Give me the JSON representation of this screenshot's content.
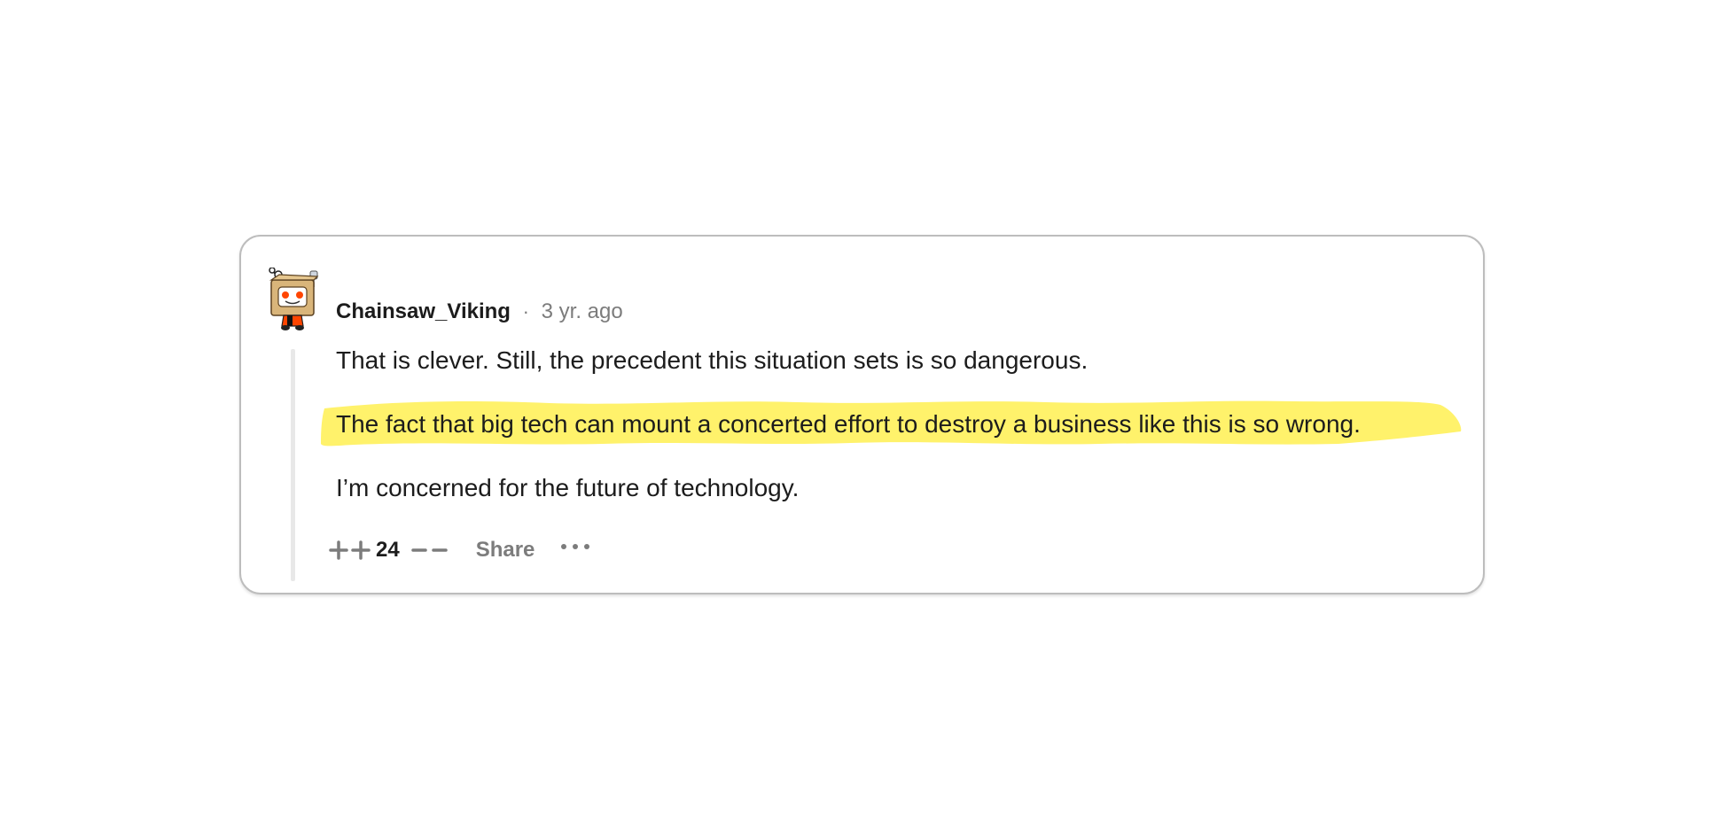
{
  "comment": {
    "username": "Chainsaw_Viking",
    "separator": "·",
    "timestamp": "3 yr. ago",
    "avatar_icon": "reddit-snoo-box-avatar-icon",
    "paragraphs": [
      "That is clever. Still, the precedent this situation sets is so dangerous.",
      "The fact that big tech can mount a concerted effort to destroy a business like this is so wrong.",
      "I’m concerned for the future of technology."
    ],
    "highlight_color": "#fff26b",
    "actions": {
      "upvote_icon": "double-plus-icon",
      "score": "24",
      "downvote_icon": "double-minus-icon",
      "share_label": "Share",
      "more_icon": "ellipsis-icon"
    }
  }
}
